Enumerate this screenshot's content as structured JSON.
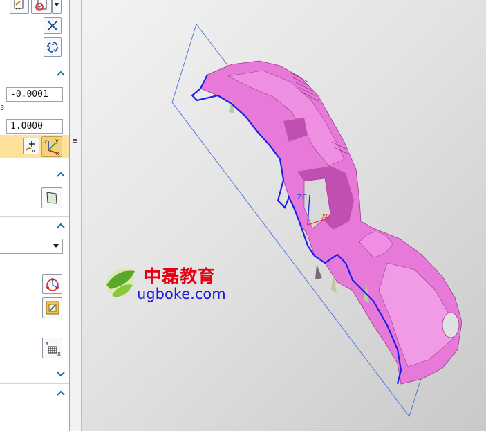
{
  "panel": {
    "params": {
      "value_1": "-0.0001",
      "index_label": "3",
      "value_2": "1.0000"
    }
  },
  "splitter": {
    "grip": "≡"
  },
  "viewport": {
    "axes": {
      "z_label": "ZC",
      "x_label": "XC"
    },
    "watermark": {
      "cn_text": "中磊教育",
      "en_text": "ugboke.com"
    }
  },
  "colors": {
    "part": "#e779d8",
    "part_dark": "#bf4fb0",
    "edge": "#1d1df0",
    "plane": "#5577dd",
    "section_highlight": "#ffe29a",
    "accent_chevron": "#1f6f9a"
  }
}
